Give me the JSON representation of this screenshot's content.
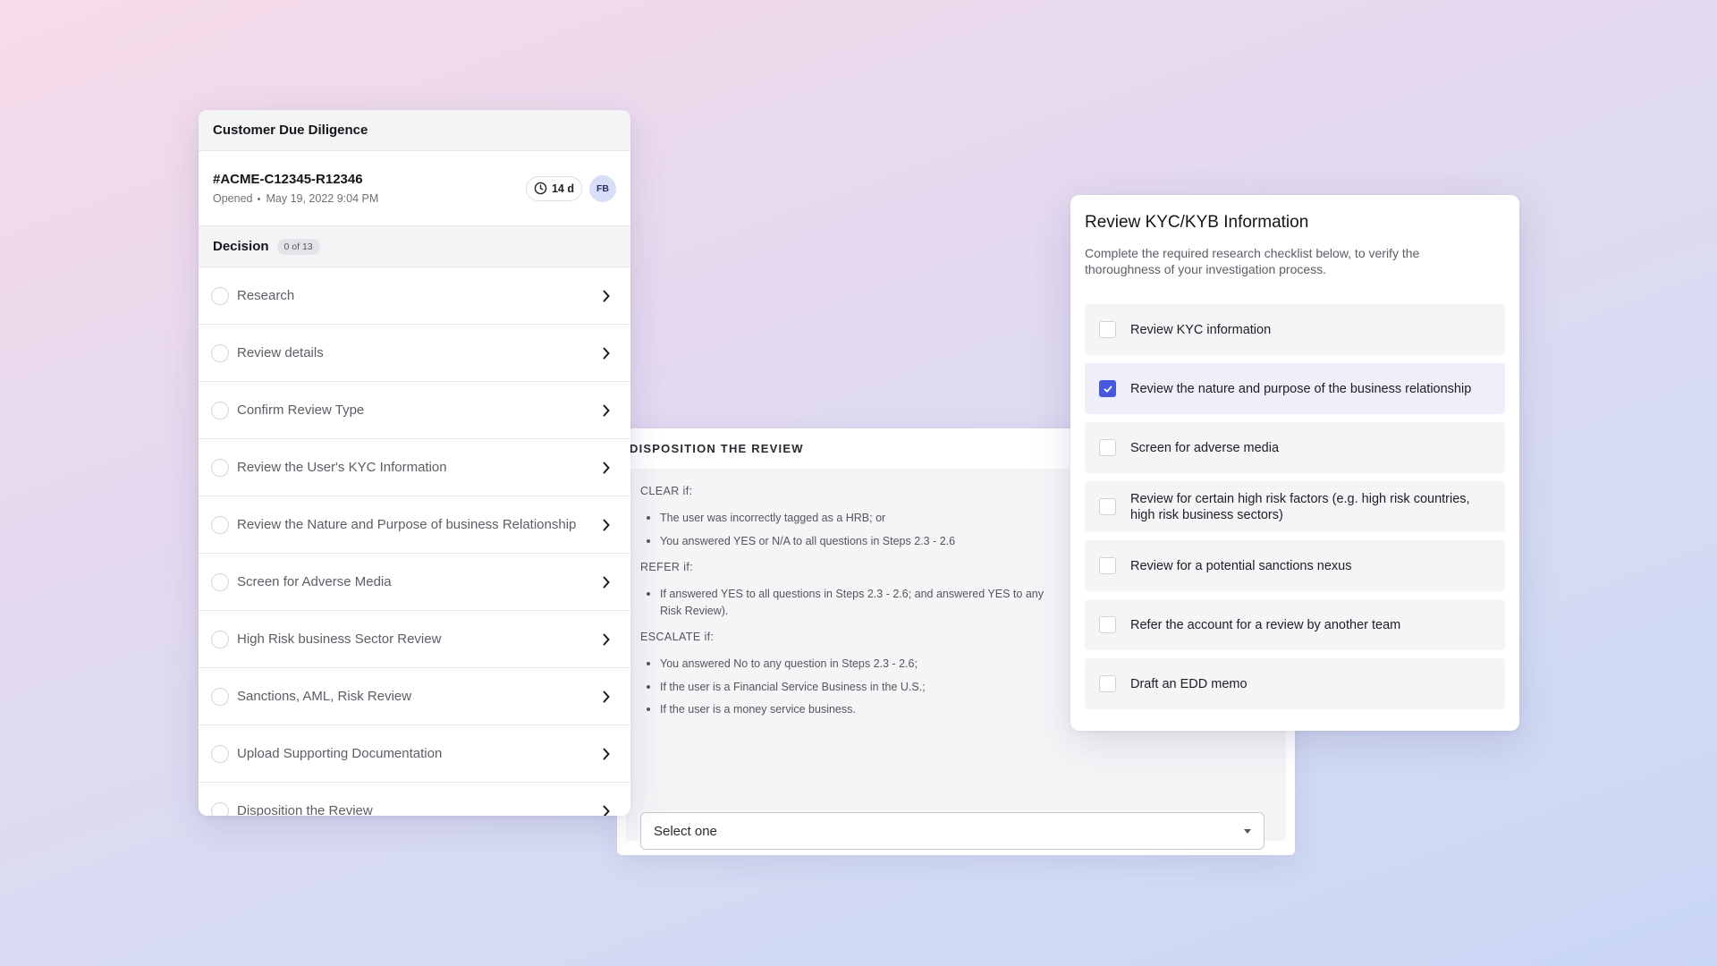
{
  "cdd": {
    "title": "Customer Due Diligence",
    "case_id": "#ACME-C12345-R12346",
    "opened_label": "Opened",
    "opened_date": "May 19, 2022 9:04 PM",
    "timer": "14 d",
    "avatar_initials": "FB",
    "decision_label": "Decision",
    "decision_count": "0 of 13",
    "steps": [
      {
        "label": "Research"
      },
      {
        "label": "Review details"
      },
      {
        "label": "Confirm Review Type"
      },
      {
        "label": "Review the User's KYC Information"
      },
      {
        "label": "Review the Nature and Purpose of business Relationship"
      },
      {
        "label": "Screen for Adverse Media"
      },
      {
        "label": "High Risk business Sector Review"
      },
      {
        "label": "Sanctions, AML, Risk Review"
      },
      {
        "label": "Upload Supporting Documentation"
      },
      {
        "label": "Disposition the Review"
      }
    ]
  },
  "disposition": {
    "title": "DISPOSITION THE REVIEW",
    "clear_head": "CLEAR if:",
    "clear_items": [
      "The user was incorrectly tagged as a HRB; or",
      "You answered YES or N/A to all questions in Steps 2.3 - 2.6"
    ],
    "refer_head": "REFER if:",
    "refer_items": [
      "If answered YES to all questions in Steps 2.3 - 2.6; and answered YES to any Risk Review)."
    ],
    "escalate_head": "ESCALATE if:",
    "escalate_items": [
      "You answered No to any question in Steps 2.3 - 2.6;",
      "If the user is a Financial Service Business in the U.S.;",
      "If the user is a money service business."
    ],
    "select_value": "Select one"
  },
  "kyc": {
    "title": "Review KYC/KYB Information",
    "description": "Complete the required research checklist below, to verify the thoroughness of your investigation process.",
    "items": [
      {
        "label": "Review KYC information",
        "checked": false
      },
      {
        "label": "Review the nature and purpose of the business relationship",
        "checked": true
      },
      {
        "label": "Screen for adverse media",
        "checked": false
      },
      {
        "label": "Review for certain high risk factors (e.g. high risk countries, high risk business sectors)",
        "checked": false
      },
      {
        "label": "Review for a potential sanctions nexus",
        "checked": false
      },
      {
        "label": "Refer the account for a review by another team",
        "checked": false
      },
      {
        "label": "Draft an EDD memo",
        "checked": false
      }
    ],
    "accent_color": "#4458e0"
  }
}
